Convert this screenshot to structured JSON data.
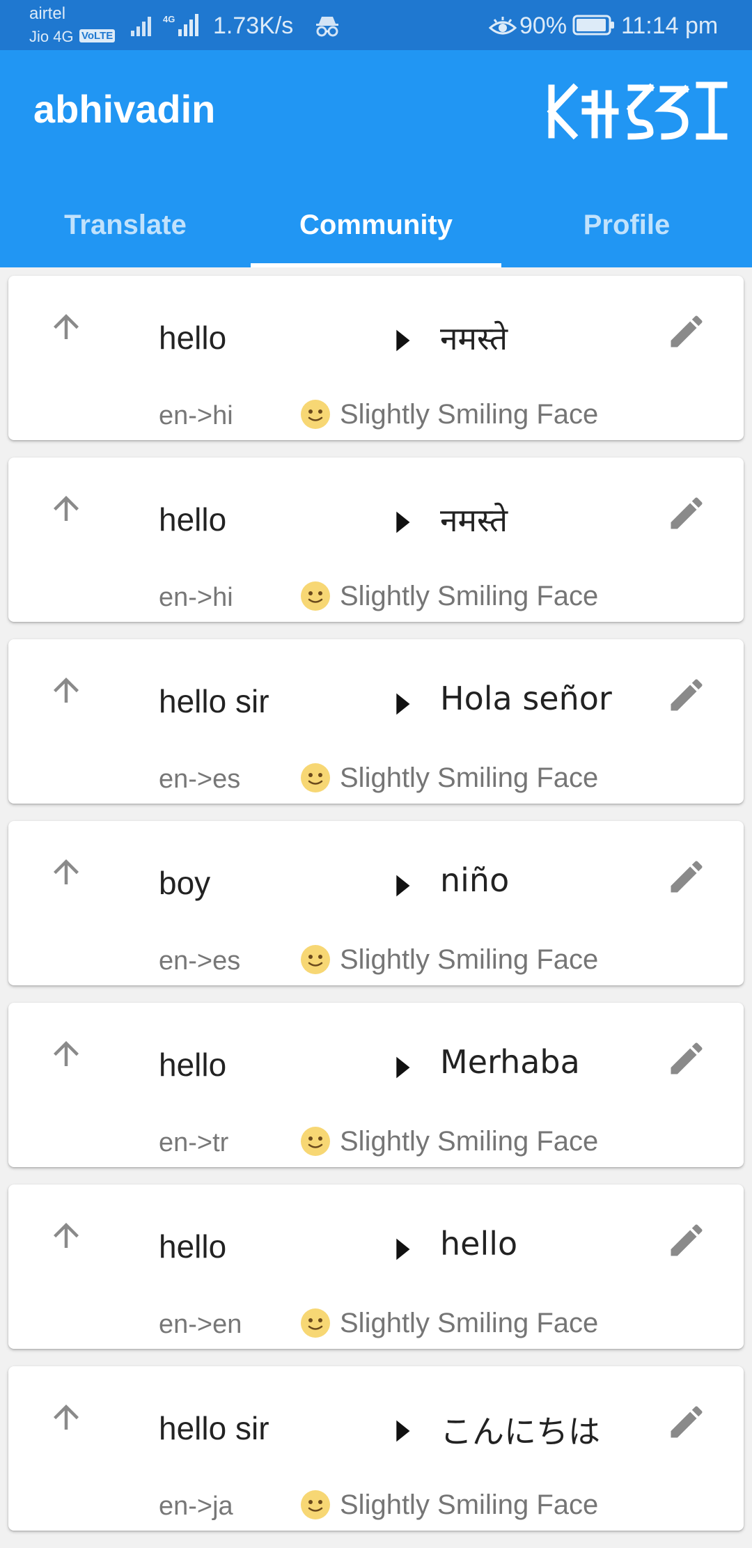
{
  "status_bar": {
    "carrier1": "airtel",
    "carrier2": "Jio 4G",
    "volte": "VoLTE",
    "network_label": "4G",
    "net_speed": "1.73K/s",
    "battery": "90%",
    "time": "11:14 pm"
  },
  "app": {
    "title": "abhivadin",
    "accent": "#2196f3"
  },
  "tabs": [
    {
      "label": "Translate",
      "active": false
    },
    {
      "label": "Community",
      "active": true
    },
    {
      "label": "Profile",
      "active": false
    }
  ],
  "translations": [
    {
      "source": "hello",
      "target": "नमस्ते",
      "pair": "en->hi",
      "reaction": "Slightly Smiling Face"
    },
    {
      "source": "hello",
      "target": "नमस्ते",
      "pair": "en->hi",
      "reaction": "Slightly Smiling Face"
    },
    {
      "source": "hello sir",
      "target": "Hola señor",
      "pair": "en->es",
      "reaction": "Slightly Smiling Face"
    },
    {
      "source": "boy",
      "target": "niño",
      "pair": "en->es",
      "reaction": "Slightly Smiling Face"
    },
    {
      "source": "hello",
      "target": "Merhaba",
      "pair": "en->tr",
      "reaction": "Slightly Smiling Face"
    },
    {
      "source": "hello",
      "target": "hello",
      "pair": "en->en",
      "reaction": "Slightly Smiling Face"
    },
    {
      "source": "hello sir",
      "target": "こんにちは",
      "pair": "en->ja",
      "reaction": "Slightly Smiling Face"
    }
  ],
  "icons": {
    "upvote": "arrow-up-icon",
    "direction": "play-arrow-icon",
    "edit": "pencil-icon",
    "reaction": "slightly-smiling-face-emoji"
  }
}
